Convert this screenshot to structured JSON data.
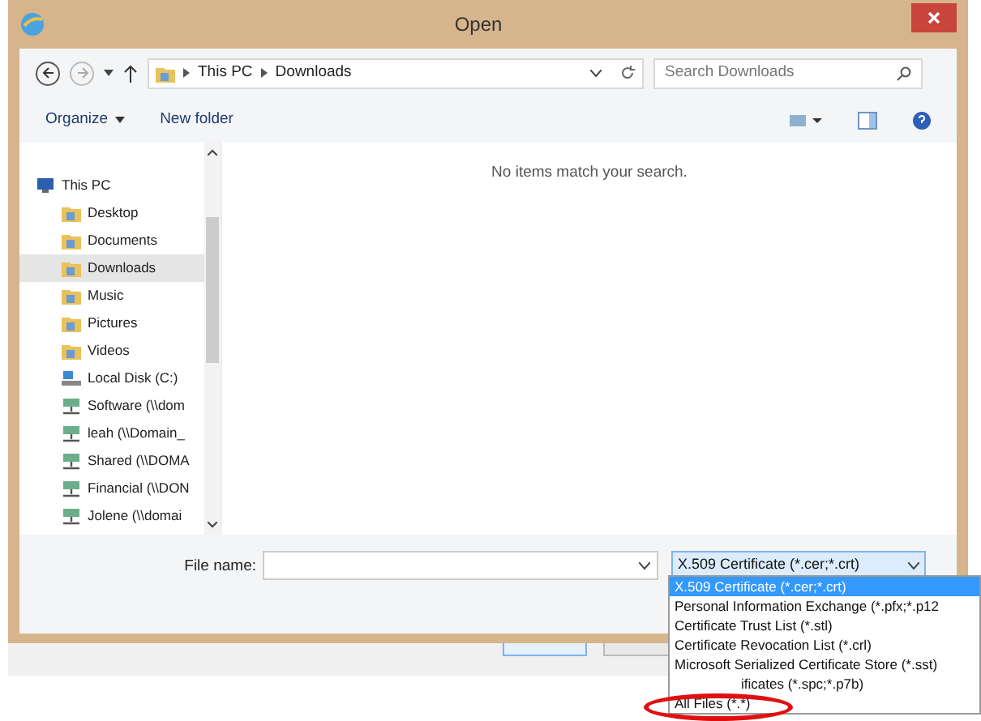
{
  "window": {
    "title": "Open"
  },
  "address": {
    "path": [
      "This PC",
      "Downloads"
    ]
  },
  "search": {
    "placeholder": "Search Downloads"
  },
  "toolbar": {
    "organize": "Organize",
    "new_folder": "New folder"
  },
  "nav": {
    "items": [
      {
        "label": "This PC",
        "kind": "computer",
        "selected": false,
        "children": [
          {
            "label": "Desktop",
            "kind": "folder",
            "selected": false
          },
          {
            "label": "Documents",
            "kind": "folder",
            "selected": false
          },
          {
            "label": "Downloads",
            "kind": "folder",
            "selected": true
          },
          {
            "label": "Music",
            "kind": "folder",
            "selected": false
          },
          {
            "label": "Pictures",
            "kind": "folder",
            "selected": false
          },
          {
            "label": "Videos",
            "kind": "folder",
            "selected": false
          },
          {
            "label": "Local Disk (C:)",
            "kind": "drive",
            "selected": false
          },
          {
            "label": "Software (\\\\dom",
            "kind": "network",
            "selected": false
          },
          {
            "label": "leah (\\\\Domain_",
            "kind": "network",
            "selected": false
          },
          {
            "label": "Shared (\\\\DOMA",
            "kind": "network",
            "selected": false
          },
          {
            "label": "Financial (\\\\DON",
            "kind": "network",
            "selected": false
          },
          {
            "label": "Jolene (\\\\domai",
            "kind": "network",
            "selected": false
          }
        ]
      }
    ]
  },
  "content": {
    "message": "No items match your search."
  },
  "file_name": {
    "label": "File name:"
  },
  "file_type": {
    "value": "X.509 Certificate (*.cer;*.crt)",
    "expanded": true,
    "options": [
      {
        "label": "X.509 Certificate (*.cer;*.crt)",
        "selected": true
      },
      {
        "label": "Personal Information Exchange (*.pfx;*.p12",
        "selected": false
      },
      {
        "label": "Certificate Trust List (*.stl)",
        "selected": false
      },
      {
        "label": "Certificate Revocation List (*.crl)",
        "selected": false
      },
      {
        "label": "Microsoft Serialized Certificate Store (*.sst)",
        "selected": false
      },
      {
        "label": "ificates (*.spc;*.p7b)",
        "selected": false
      },
      {
        "label": "All Files (*.*)",
        "selected": false
      }
    ]
  }
}
